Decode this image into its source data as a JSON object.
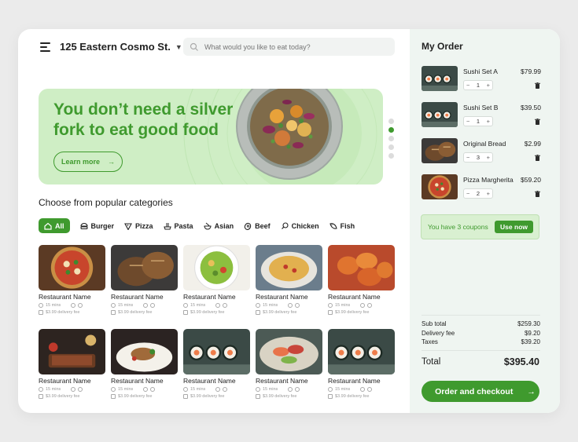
{
  "header": {
    "address": "125 Eastern Cosmo St.",
    "search_placeholder": "What would you like to eat today?"
  },
  "hero": {
    "title": "You don’t need a silver fork to eat good food",
    "cta_label": "Learn more",
    "carousel_dots": 5,
    "active_dot": 1
  },
  "categories": {
    "heading": "Choose from popular categories",
    "items": [
      {
        "label": "All",
        "icon": "home-icon",
        "active": true
      },
      {
        "label": "Burger",
        "icon": "burger-icon",
        "active": false
      },
      {
        "label": "Pizza",
        "icon": "pizza-icon",
        "active": false
      },
      {
        "label": "Pasta",
        "icon": "pasta-icon",
        "active": false
      },
      {
        "label": "Asian",
        "icon": "asian-bowl-icon",
        "active": false
      },
      {
        "label": "Beef",
        "icon": "beef-icon",
        "active": false
      },
      {
        "label": "Chicken",
        "icon": "chicken-icon",
        "active": false
      },
      {
        "label": "Fish",
        "icon": "fish-icon",
        "active": false
      }
    ]
  },
  "restaurants": [
    {
      "name": "Restaurant Name",
      "time": "15 mins",
      "fee": "$3.99 delivery fee",
      "food": "pizza"
    },
    {
      "name": "Restaurant Name",
      "time": "15 mins",
      "fee": "$3.99 delivery fee",
      "food": "bread"
    },
    {
      "name": "Restaurant Name",
      "time": "15 mins",
      "fee": "$3.99 delivery fee",
      "food": "salad"
    },
    {
      "name": "Restaurant Name",
      "time": "15 mins",
      "fee": "$3.99 delivery fee",
      "food": "spaghetti"
    },
    {
      "name": "Restaurant Name",
      "time": "15 mins",
      "fee": "$3.99 delivery fee",
      "food": "wings"
    },
    {
      "name": "Restaurant Name",
      "time": "15 mins",
      "fee": "$3.99 delivery fee",
      "food": "steak"
    },
    {
      "name": "Restaurant Name",
      "time": "15 mins",
      "fee": "$3.99 delivery fee",
      "food": "fine-dining"
    },
    {
      "name": "Restaurant Name",
      "time": "15 mins",
      "fee": "$3.99 delivery fee",
      "food": "sushi"
    },
    {
      "name": "Restaurant Name",
      "time": "15 mins",
      "fee": "$3.99 delivery fee",
      "food": "sashimi"
    },
    {
      "name": "Restaurant Name",
      "time": "15 mins",
      "fee": "$3.99 delivery fee",
      "food": "sushi"
    }
  ],
  "order": {
    "title": "My Order",
    "items": [
      {
        "name": "Sushi Set A",
        "price": "$79.99",
        "qty": "1",
        "food": "sushi"
      },
      {
        "name": "Sushi Set B",
        "price": "$39.50",
        "qty": "1",
        "food": "sushi"
      },
      {
        "name": "Original Bread",
        "price": "$2.99",
        "qty": "3",
        "food": "bread"
      },
      {
        "name": "Pizza Margherita",
        "price": "$59.20",
        "qty": "2",
        "food": "pizza"
      }
    ],
    "coupon_text": "You have 3 coupons",
    "coupon_button": "Use now",
    "subtotal_label": "Sub total",
    "subtotal": "$259.30",
    "delivery_label": "Delivery fee",
    "delivery": "$9.20",
    "taxes_label": "Taxes",
    "taxes": "$39.20",
    "total_label": "Total",
    "total": "$395.40",
    "checkout_label": "Order and checkout"
  },
  "colors": {
    "accent": "#3f9a2e",
    "hero_bg": "#cfeec5",
    "sidebar_bg": "#eff5f1"
  }
}
